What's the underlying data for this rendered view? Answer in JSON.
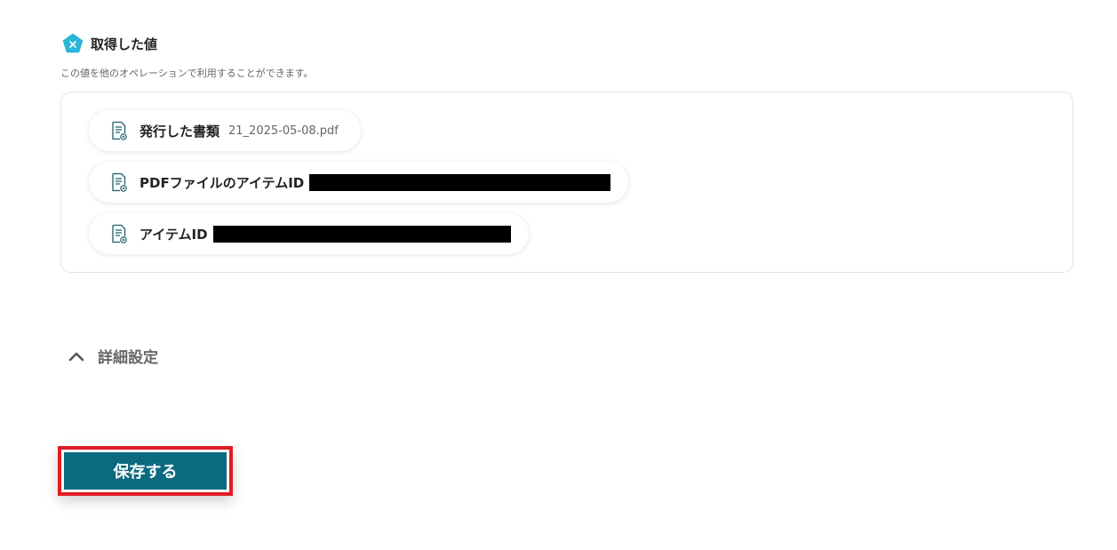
{
  "section": {
    "icon": "pentagon-x-icon",
    "title": "取得した値",
    "description": "この値を他のオペレーションで利用することができます。"
  },
  "values": [
    {
      "icon": "document-icon",
      "label": "発行した書類",
      "value": "21_2025-05-08.pdf",
      "redacted": false
    },
    {
      "icon": "document-icon",
      "label": "PDFファイルのアイテムID",
      "value": "",
      "redacted": true
    },
    {
      "icon": "document-icon",
      "label": "アイテムID",
      "value": "",
      "redacted": true
    }
  ],
  "advanced": {
    "icon": "chevron-up-icon",
    "label": "詳細設定"
  },
  "save_button": {
    "label": "保存する"
  },
  "colors": {
    "accent_icon": "#2bb5d8",
    "primary_button": "#0c6a80",
    "highlight_outline": "#e11b22"
  }
}
